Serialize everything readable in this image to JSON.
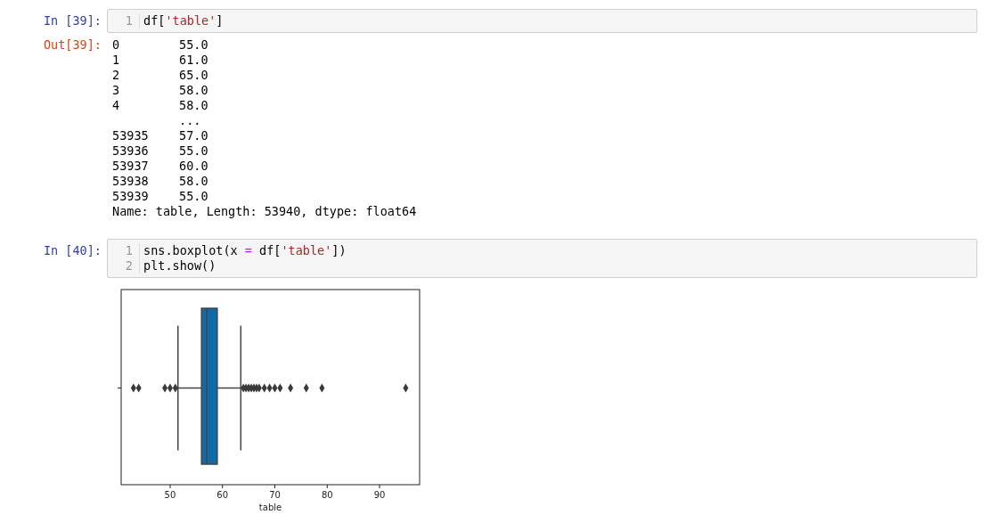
{
  "cells": [
    {
      "kind": "input",
      "prompt": "In [39]:",
      "lines": [
        {
          "number": "1",
          "tokens": [
            {
              "kind": "plain",
              "text": "df["
            },
            {
              "kind": "string",
              "text": "'table'"
            },
            {
              "kind": "plain",
              "text": "]"
            }
          ]
        }
      ]
    },
    {
      "kind": "output",
      "prompt": "Out[39]:",
      "rows": [
        {
          "index": "0",
          "value": "55.0"
        },
        {
          "index": "1",
          "value": "61.0"
        },
        {
          "index": "2",
          "value": "65.0"
        },
        {
          "index": "3",
          "value": "58.0"
        },
        {
          "index": "4",
          "value": "58.0"
        },
        {
          "value": "..."
        },
        {
          "index": "53935",
          "value": "57.0"
        },
        {
          "index": "53936",
          "value": "55.0"
        },
        {
          "index": "53937",
          "value": "60.0"
        },
        {
          "index": "53938",
          "value": "58.0"
        },
        {
          "index": "53939",
          "value": "55.0"
        }
      ],
      "footer": "Name: table, Length: 53940, dtype: float64"
    },
    {
      "kind": "input",
      "prompt": "In [40]:",
      "lines": [
        {
          "number": "1",
          "tokens": [
            {
              "kind": "plain",
              "text": "sns.boxplot(x "
            },
            {
              "kind": "operator",
              "text": "="
            },
            {
              "kind": "plain",
              "text": " df["
            },
            {
              "kind": "string",
              "text": "'table'"
            },
            {
              "kind": "plain",
              "text": "])"
            }
          ]
        },
        {
          "number": "2",
          "tokens": [
            {
              "kind": "plain",
              "text": "plt.show()"
            }
          ]
        }
      ]
    },
    {
      "kind": "plot",
      "tick_labels": [
        "50",
        "60",
        "70",
        "80",
        "90"
      ],
      "axis_label": "table"
    }
  ]
}
